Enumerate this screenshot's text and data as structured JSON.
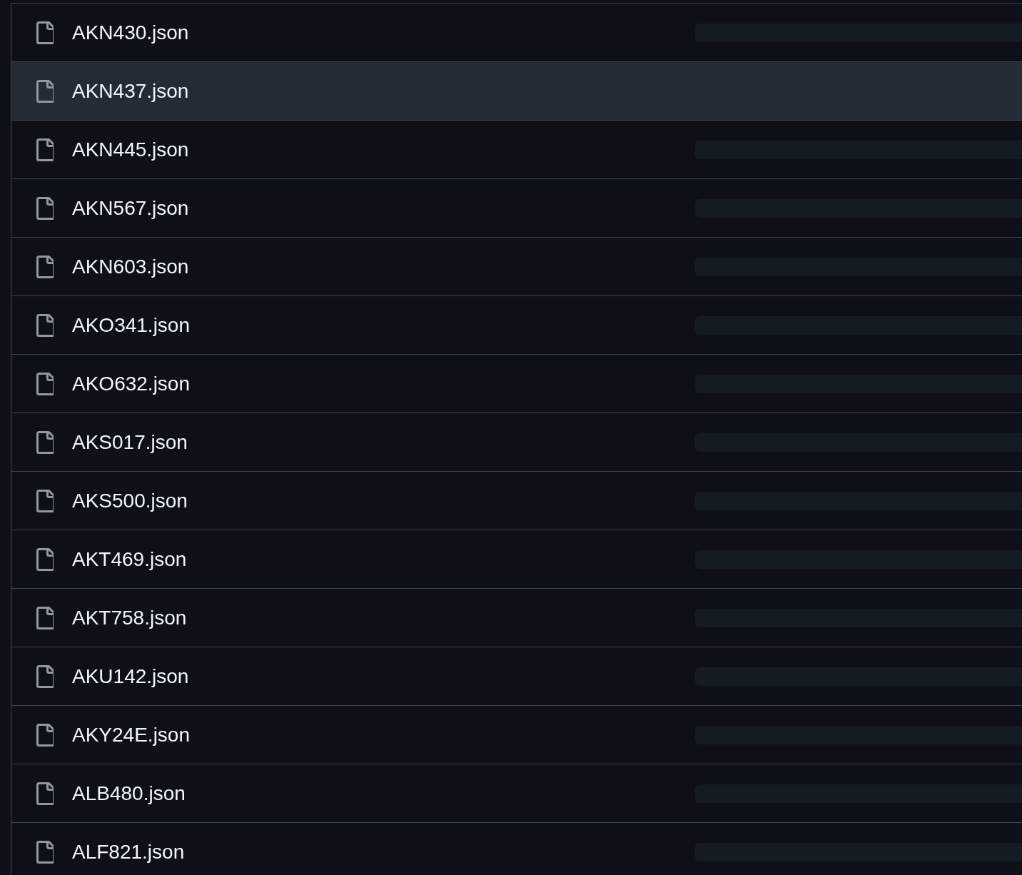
{
  "files": [
    {
      "name": "AKN430.json",
      "highlighted": false
    },
    {
      "name": "AKN437.json",
      "highlighted": true
    },
    {
      "name": "AKN445.json",
      "highlighted": false
    },
    {
      "name": "AKN567.json",
      "highlighted": false
    },
    {
      "name": "AKN603.json",
      "highlighted": false
    },
    {
      "name": "AKO341.json",
      "highlighted": false
    },
    {
      "name": "AKO632.json",
      "highlighted": false
    },
    {
      "name": "AKS017.json",
      "highlighted": false
    },
    {
      "name": "AKS500.json",
      "highlighted": false
    },
    {
      "name": "AKT469.json",
      "highlighted": false
    },
    {
      "name": "AKT758.json",
      "highlighted": false
    },
    {
      "name": "AKU142.json",
      "highlighted": false
    },
    {
      "name": "AKY24E.json",
      "highlighted": false
    },
    {
      "name": "ALB480.json",
      "highlighted": false
    },
    {
      "name": "ALF821.json",
      "highlighted": false
    }
  ]
}
